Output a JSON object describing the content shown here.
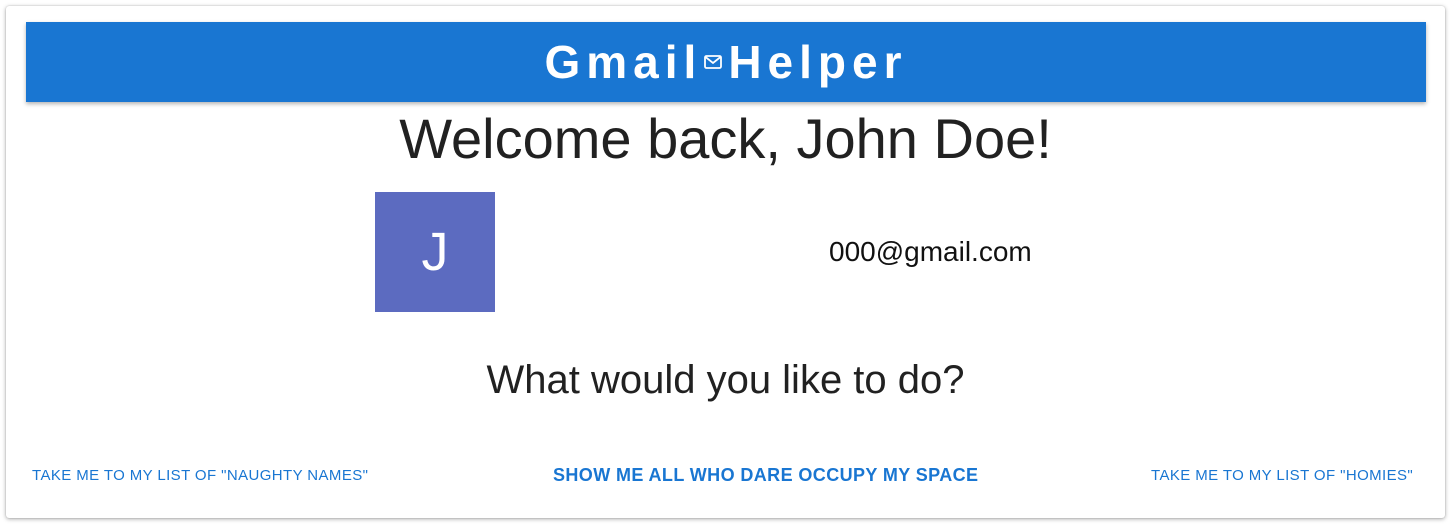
{
  "header": {
    "title_left": "Gmail",
    "title_right": "Helper",
    "icon": "mail-icon",
    "color": "#1976d2"
  },
  "welcome": {
    "text": "Welcome back, John Doe!"
  },
  "profile": {
    "avatar_letter": "J",
    "avatar_color": "#5c6bc0",
    "email": "000@gmail.com"
  },
  "prompt": {
    "text": "What would you like to do?"
  },
  "actions": [
    {
      "label": "Take me to my list of \"naughty names\""
    },
    {
      "label": "Show me all who dare occupy my space"
    },
    {
      "label": "Take me to my list of \"homies\""
    }
  ]
}
